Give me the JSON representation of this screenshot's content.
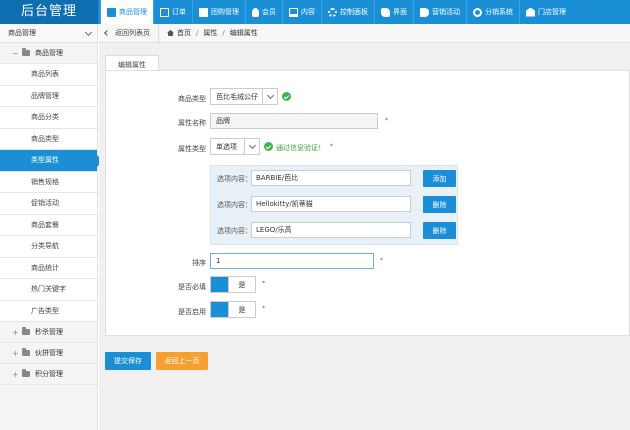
{
  "app": {
    "brand": "后台管理"
  },
  "topnav": [
    {
      "label": "商品管理",
      "icon": "goods-icon"
    },
    {
      "label": "订单",
      "icon": "order-icon"
    },
    {
      "label": "团购管理",
      "icon": "groupbuy-icon"
    },
    {
      "label": "会员",
      "icon": "member-icon"
    },
    {
      "label": "内容",
      "icon": "content-icon"
    },
    {
      "label": "控制面板",
      "icon": "gear-icon"
    },
    {
      "label": "界面",
      "icon": "puzzle-icon"
    },
    {
      "label": "营销活动",
      "icon": "tag-icon"
    },
    {
      "label": "分销系统",
      "icon": "share-icon"
    },
    {
      "label": "门店管理",
      "icon": "store-icon"
    }
  ],
  "sidebar": {
    "title": "商品管理",
    "group": "商品管理",
    "items": [
      "商品列表",
      "品牌管理",
      "商品分类",
      "商品类型",
      "类型属性",
      "销售规格",
      "促销活动",
      "商品套餐",
      "分类导航",
      "商品统计",
      "热门关键字",
      "广告类型"
    ],
    "active_index": 4,
    "collapsed_groups": [
      "秒杀管理",
      "伙拼管理",
      "积分管理"
    ]
  },
  "breadcrumb": {
    "back": "返回列表页",
    "home": "首页",
    "parent": "属性",
    "current": "编辑属性",
    "sep": "/"
  },
  "tab": "编辑属性",
  "form": {
    "goods_type_label": "商品类型",
    "goods_type_value": "芭比毛绒公仔",
    "attr_name_label": "属性名称",
    "attr_name_value": "品牌",
    "attr_type_label": "属性类型",
    "attr_type_value": "单选项",
    "validation_msg": "通过信息验证！",
    "required_mark": "*",
    "option_label": "选项内容：",
    "options": [
      "BARBIE/芭比",
      "Hellokitty/凯蒂猫",
      "LEGO/乐高"
    ],
    "add_button": "添加",
    "delete_button": "删除",
    "sort_label": "排序",
    "sort_value": "1",
    "required_label": "是否必填",
    "enabled_label": "是否启用",
    "yes": "是"
  },
  "actions": {
    "save": "提交保存",
    "back": "返回上一页"
  }
}
